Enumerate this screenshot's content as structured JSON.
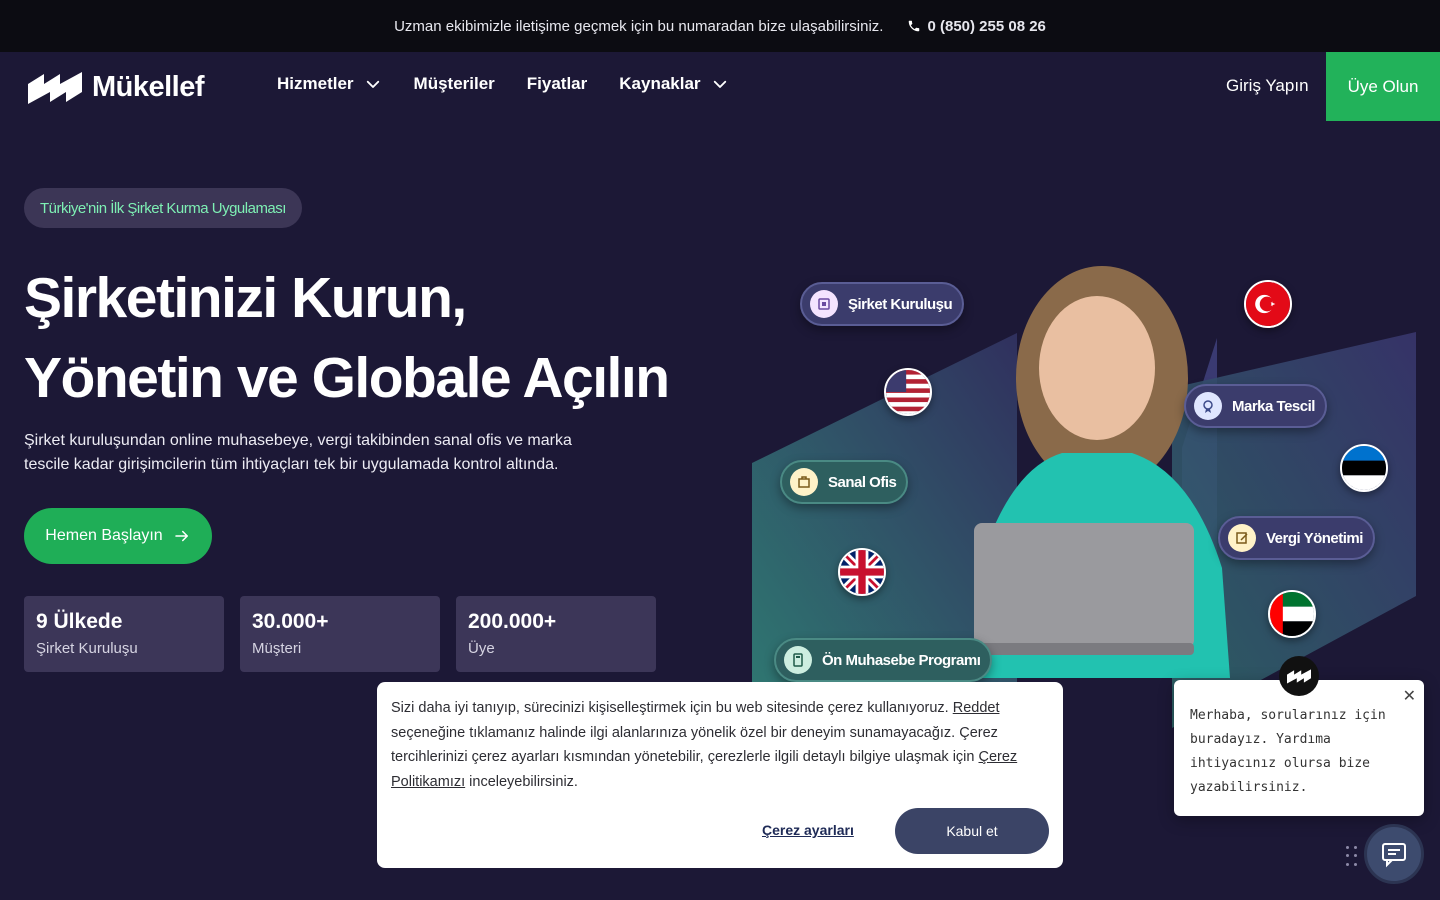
{
  "topbar": {
    "message": "Uzman ekibimizle iletişime geçmek için bu numaradan bize ulaşabilirsiniz.",
    "phone": "0 (850) 255 08 26"
  },
  "nav": {
    "logo": "Mükellef",
    "links": [
      {
        "label": "Hizmetler",
        "icon": "chevron-down-icon"
      },
      {
        "label": "Müşteriler"
      },
      {
        "label": "Fiyatlar"
      },
      {
        "label": "Kaynaklar",
        "icon": "chevron-down-icon"
      }
    ],
    "login": "Giriş Yapın",
    "signup": "Üye Olun"
  },
  "hero": {
    "badge": "Türkiye'nin İlk Şirket Kurma Uygulaması",
    "title_line1": "Şirketinizi Kurun,",
    "title_line2": "Yönetin ve Globale Açılın",
    "description": "Şirket kuruluşundan online muhasebeye, vergi takibinden sanal ofis ve marka tescile kadar girişimcilerin tüm ihtiyaçları tek bir uygulamada kontrol altında.",
    "cta": "Hemen Başlayın"
  },
  "stats": [
    {
      "value": "9 Ülkede",
      "label": "Şirket Kuruluşu"
    },
    {
      "value": "30.000+",
      "label": "Müşteri"
    },
    {
      "value": "200.000+",
      "label": "Üye"
    }
  ],
  "illustration": {
    "chips": [
      "Şirket Kuruluşu",
      "Marka Tescil",
      "Sanal Ofis",
      "Vergi Yönetimi",
      "Ön Muhasebe Programı"
    ],
    "flags": [
      "turkey-flag-icon",
      "usa-flag-icon",
      "estonia-flag-icon",
      "uk-flag-icon",
      "uae-flag-icon"
    ]
  },
  "cookie": {
    "text_1": "Sizi daha iyi tanıyıp, sürecinizi kişiselleştirmek için bu web sitesinde çerez kullanıyoruz.",
    "reject_link": "Reddet",
    "text_2": "seçeneğine tıklamanız halinde ilgi alanlarınıza yönelik özel bir deneyim sunamayacağız. Çerez tercihlerinizi çerez ayarları kısmından yönetebilir, çerezlerle ilgili detaylı bilgiye ulaşmak için",
    "policy_link": "Çerez Politikamızı",
    "text_3": "inceleyebilirsiniz.",
    "settings": "Çerez ayarları",
    "accept": "Kabul et"
  },
  "chat": {
    "message": "Merhaba, sorularınız için buradayız. Yardıma ihtiyacınız olursa bize yazabilirsiniz.",
    "close": "✕"
  },
  "colors": {
    "background": "#1c1836",
    "accent_green": "#22b25a",
    "badge_text": "#7ef0b4"
  }
}
